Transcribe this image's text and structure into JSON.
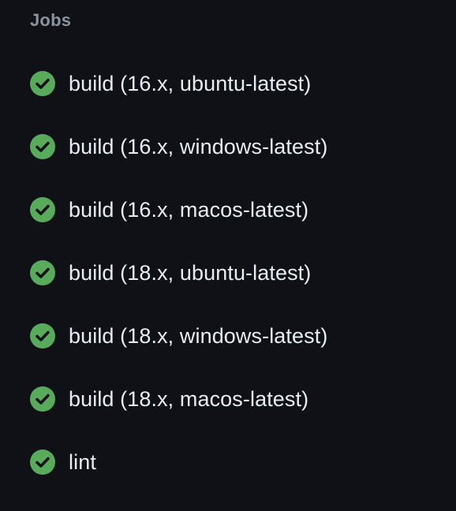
{
  "section": {
    "title": "Jobs"
  },
  "colors": {
    "success": "#57ab5a",
    "background": "#0f1117",
    "text": "#e6edf3",
    "muted": "#8b949e"
  },
  "jobs": [
    {
      "label": "build (16.x, ubuntu-latest)",
      "status": "success",
      "icon": "check-circle-icon"
    },
    {
      "label": "build (16.x, windows-latest)",
      "status": "success",
      "icon": "check-circle-icon"
    },
    {
      "label": "build (16.x, macos-latest)",
      "status": "success",
      "icon": "check-circle-icon"
    },
    {
      "label": "build (18.x, ubuntu-latest)",
      "status": "success",
      "icon": "check-circle-icon"
    },
    {
      "label": "build (18.x, windows-latest)",
      "status": "success",
      "icon": "check-circle-icon"
    },
    {
      "label": "build (18.x, macos-latest)",
      "status": "success",
      "icon": "check-circle-icon"
    },
    {
      "label": "lint",
      "status": "success",
      "icon": "check-circle-icon"
    }
  ]
}
